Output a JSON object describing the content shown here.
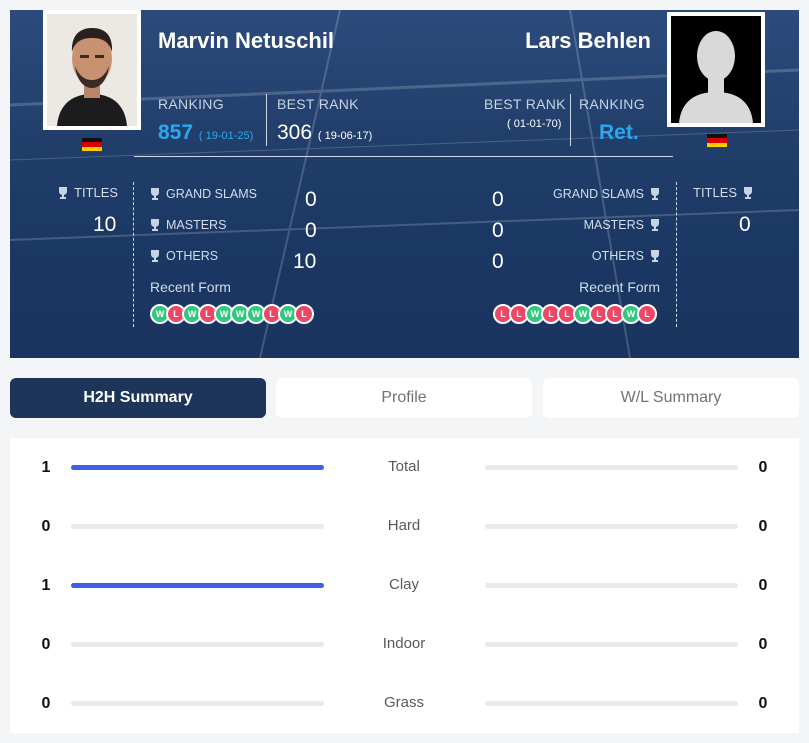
{
  "player1": {
    "name": "Marvin Netuschil",
    "ranking_label": "RANKING",
    "ranking": "857",
    "ranking_date": "( 19-01-25)",
    "best_rank_label": "BEST RANK",
    "best_rank": "306",
    "best_rank_date": "( 19-06-17)",
    "titles_label": "TITLES",
    "titles": "10",
    "grand_slams_label": "GRAND SLAMS",
    "grand_slams": "0",
    "masters_label": "MASTERS",
    "masters": "0",
    "others_label": "OTHERS",
    "others": "10",
    "recent_form_label": "Recent Form",
    "recent_form": [
      "W",
      "L",
      "W",
      "L",
      "W",
      "W",
      "W",
      "L",
      "W",
      "L"
    ]
  },
  "player2": {
    "name": "Lars Behlen",
    "ranking_label": "RANKING",
    "ranking": "Ret.",
    "best_rank_label": "BEST RANK",
    "best_rank_date": "( 01-01-70)",
    "titles_label": "TITLES",
    "titles": "0",
    "grand_slams_label": "GRAND SLAMS",
    "grand_slams": "0",
    "masters_label": "MASTERS",
    "masters": "0",
    "others_label": "OTHERS",
    "others": "0",
    "recent_form_label": "Recent Form",
    "recent_form": [
      "L",
      "L",
      "W",
      "L",
      "L",
      "W",
      "L",
      "L",
      "W",
      "L"
    ]
  },
  "colors": {
    "win": "#2fc97f",
    "loss": "#ef4566",
    "accent_blue": "#29a8f0",
    "bar_fill": "#3f5fe6",
    "active_tab": "#1d3559"
  },
  "tabs": [
    {
      "label": "H2H Summary",
      "active": true
    },
    {
      "label": "Profile",
      "active": false
    },
    {
      "label": "W/L Summary",
      "active": false
    }
  ],
  "h2h": [
    {
      "category": "Total",
      "p1": "1",
      "p2": "0",
      "p1_fraction": 1,
      "p2_fraction": 0
    },
    {
      "category": "Hard",
      "p1": "0",
      "p2": "0",
      "p1_fraction": 0,
      "p2_fraction": 0
    },
    {
      "category": "Clay",
      "p1": "1",
      "p2": "0",
      "p1_fraction": 1,
      "p2_fraction": 0
    },
    {
      "category": "Indoor",
      "p1": "0",
      "p2": "0",
      "p1_fraction": 0,
      "p2_fraction": 0
    },
    {
      "category": "Grass",
      "p1": "0",
      "p2": "0",
      "p1_fraction": 0,
      "p2_fraction": 0
    }
  ]
}
